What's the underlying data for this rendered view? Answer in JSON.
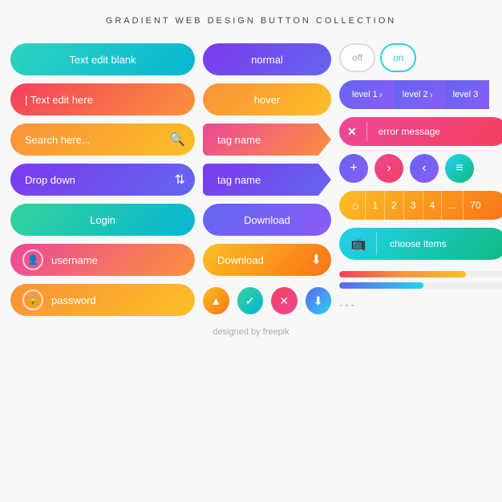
{
  "title": "GRADIENT WEB DESIGN BUTTON COLLECTION",
  "col1": {
    "btn1": "Text edit blank",
    "btn2": "| Text edit here",
    "btn3_placeholder": "Search here...",
    "btn3_icon": "🔍",
    "btn4": "Drop down",
    "btn4_icon": "⇅",
    "btn5": "Login",
    "btn6_icon": "👤",
    "btn6": "username",
    "btn7_icon": "🔒",
    "btn7": "password"
  },
  "col2": {
    "normal": "normal",
    "hover": "hover",
    "tag1": "tag name",
    "tag2": "tag name",
    "download1": "Download",
    "download2": "Download",
    "download2_icon": "⬇"
  },
  "col3": {
    "toggle_off": "off",
    "toggle_on": "on",
    "bc1": "level 1",
    "bc2": "level 2",
    "bc3": "level 3",
    "error": "error message",
    "pag_home": "⌂",
    "pag_items": [
      "1",
      "2",
      "3",
      "4",
      "...",
      "70"
    ],
    "choose": "choose items"
  },
  "footer": "designed by  freepik",
  "progress_dots": "..."
}
